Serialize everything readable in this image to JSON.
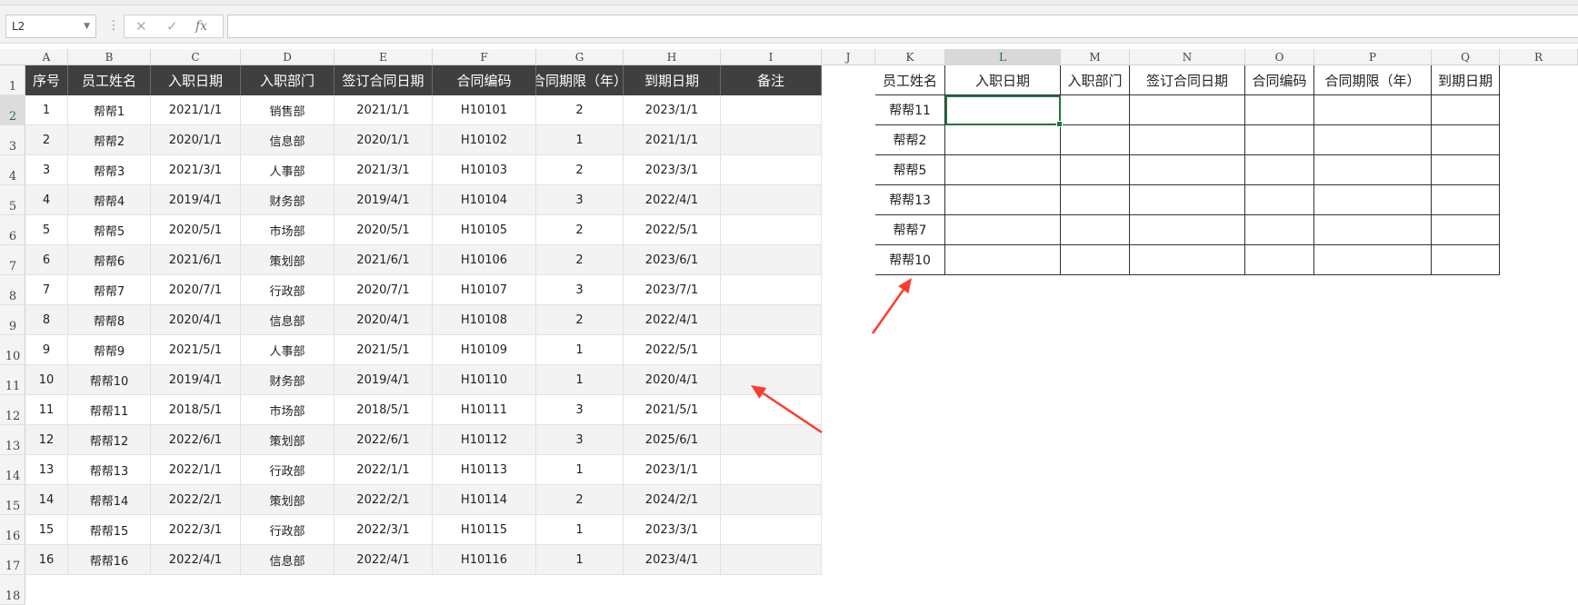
{
  "formula_bar": {
    "name_box": "L2",
    "cancel_icon": "✕",
    "enter_icon": "✓",
    "fx_label": "fx",
    "formula": ""
  },
  "columns": [
    "A",
    "B",
    "C",
    "D",
    "E",
    "F",
    "G",
    "H",
    "I",
    "J",
    "K",
    "L",
    "M",
    "N",
    "O",
    "P",
    "Q",
    "R"
  ],
  "selected_column": "L",
  "rows": [
    "1",
    "2",
    "3",
    "4",
    "5",
    "6",
    "7",
    "8",
    "9",
    "10",
    "11",
    "12",
    "13",
    "14",
    "15",
    "16",
    "17",
    "18"
  ],
  "selected_row": "2",
  "left_table": {
    "headers": [
      "序号",
      "员工姓名",
      "入职日期",
      "入职部门",
      "签订合同日期",
      "合同编码",
      "合同期限（年）",
      "到期日期",
      "备注"
    ],
    "rows": [
      [
        "1",
        "帮帮1",
        "2021/1/1",
        "销售部",
        "2021/1/1",
        "H10101",
        "2",
        "2023/1/1",
        ""
      ],
      [
        "2",
        "帮帮2",
        "2020/1/1",
        "信息部",
        "2020/1/1",
        "H10102",
        "1",
        "2021/1/1",
        ""
      ],
      [
        "3",
        "帮帮3",
        "2021/3/1",
        "人事部",
        "2021/3/1",
        "H10103",
        "2",
        "2023/3/1",
        ""
      ],
      [
        "4",
        "帮帮4",
        "2019/4/1",
        "财务部",
        "2019/4/1",
        "H10104",
        "3",
        "2022/4/1",
        ""
      ],
      [
        "5",
        "帮帮5",
        "2020/5/1",
        "市场部",
        "2020/5/1",
        "H10105",
        "2",
        "2022/5/1",
        ""
      ],
      [
        "6",
        "帮帮6",
        "2021/6/1",
        "策划部",
        "2021/6/1",
        "H10106",
        "2",
        "2023/6/1",
        ""
      ],
      [
        "7",
        "帮帮7",
        "2020/7/1",
        "行政部",
        "2020/7/1",
        "H10107",
        "3",
        "2023/7/1",
        ""
      ],
      [
        "8",
        "帮帮8",
        "2020/4/1",
        "信息部",
        "2020/4/1",
        "H10108",
        "2",
        "2022/4/1",
        ""
      ],
      [
        "9",
        "帮帮9",
        "2021/5/1",
        "人事部",
        "2021/5/1",
        "H10109",
        "1",
        "2022/5/1",
        ""
      ],
      [
        "10",
        "帮帮10",
        "2019/4/1",
        "财务部",
        "2019/4/1",
        "H10110",
        "1",
        "2020/4/1",
        ""
      ],
      [
        "11",
        "帮帮11",
        "2018/5/1",
        "市场部",
        "2018/5/1",
        "H10111",
        "3",
        "2021/5/1",
        ""
      ],
      [
        "12",
        "帮帮12",
        "2022/6/1",
        "策划部",
        "2022/6/1",
        "H10112",
        "3",
        "2025/6/1",
        ""
      ],
      [
        "13",
        "帮帮13",
        "2022/1/1",
        "行政部",
        "2022/1/1",
        "H10113",
        "1",
        "2023/1/1",
        ""
      ],
      [
        "14",
        "帮帮14",
        "2022/2/1",
        "策划部",
        "2022/2/1",
        "H10114",
        "2",
        "2024/2/1",
        ""
      ],
      [
        "15",
        "帮帮15",
        "2022/3/1",
        "行政部",
        "2022/3/1",
        "H10115",
        "1",
        "2023/3/1",
        ""
      ],
      [
        "16",
        "帮帮16",
        "2022/4/1",
        "信息部",
        "2022/4/1",
        "H10116",
        "1",
        "2023/4/1",
        ""
      ]
    ]
  },
  "right_table": {
    "headers": [
      "员工姓名",
      "入职日期",
      "入职部门",
      "签订合同日期",
      "合同编码",
      "合同期限（年）",
      "到期日期"
    ],
    "rows": [
      [
        "帮帮11",
        "",
        "",
        "",
        "",
        "",
        ""
      ],
      [
        "帮帮2",
        "",
        "",
        "",
        "",
        "",
        ""
      ],
      [
        "帮帮5",
        "",
        "",
        "",
        "",
        "",
        ""
      ],
      [
        "帮帮13",
        "",
        "",
        "",
        "",
        "",
        ""
      ],
      [
        "帮帮7",
        "",
        "",
        "",
        "",
        "",
        ""
      ],
      [
        "帮帮10",
        "",
        "",
        "",
        "",
        "",
        ""
      ]
    ]
  },
  "colors": {
    "header_fill": "#3f3f3f",
    "zebra_fill": "#f3f3f3",
    "selection": "#207245",
    "annotation_arrow": "#ff3b30"
  }
}
